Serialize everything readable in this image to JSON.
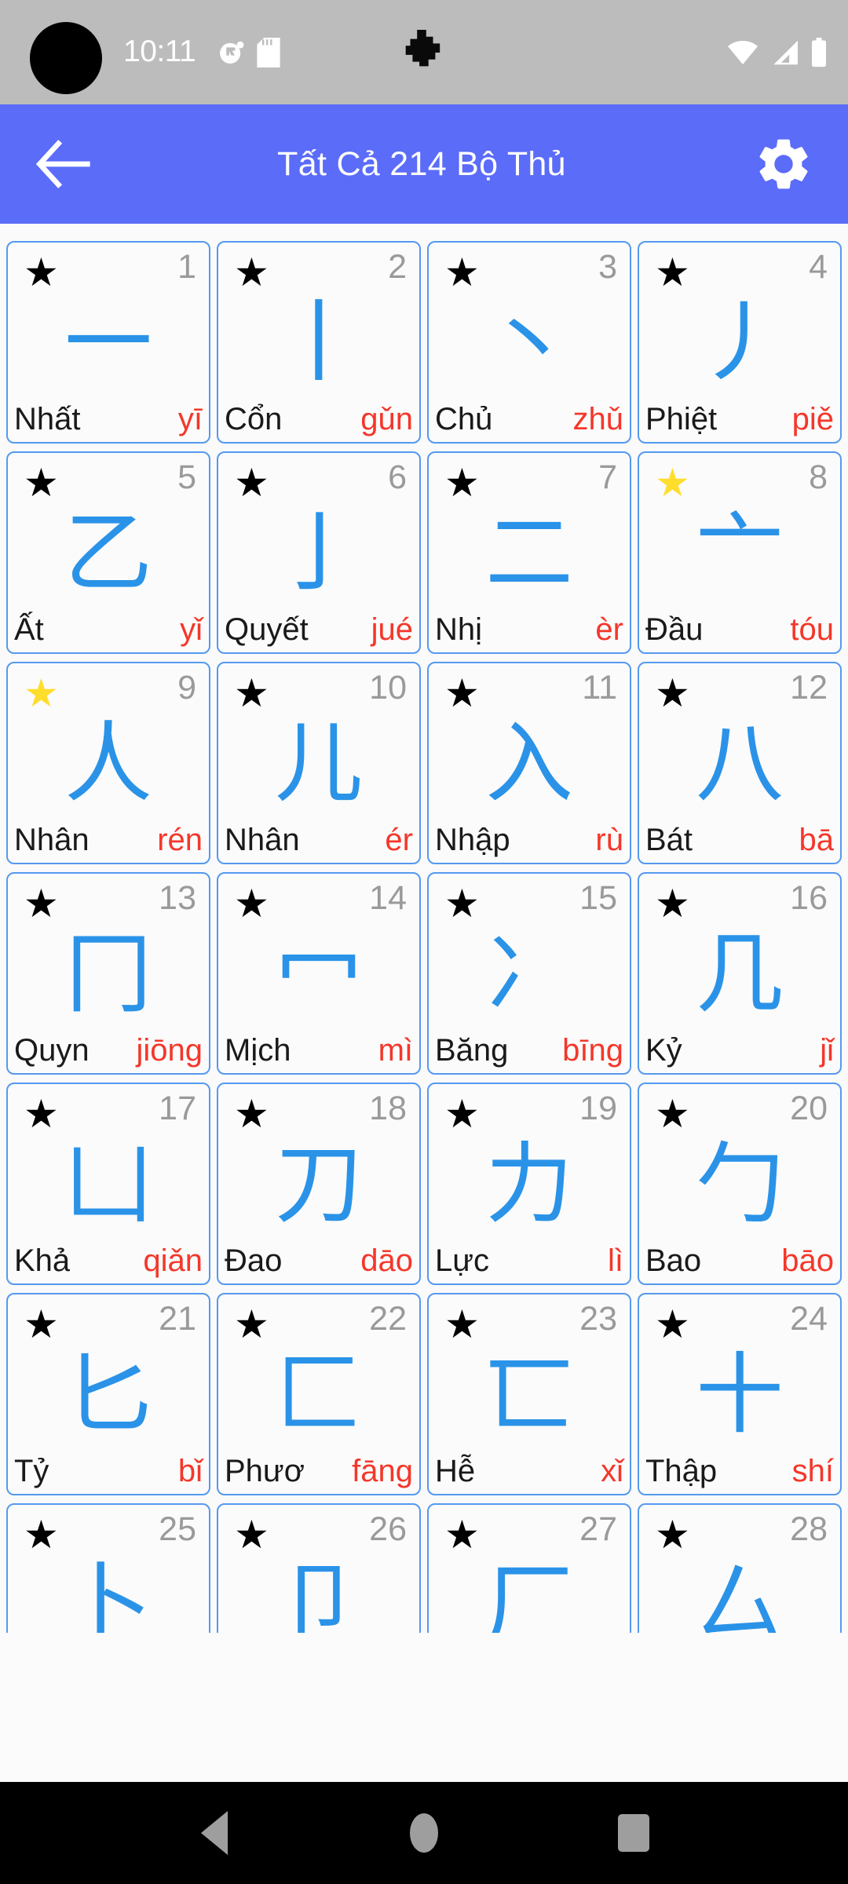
{
  "status_bar": {
    "time": "10:11",
    "icons": {
      "dnd": "do-not-disturb-icon",
      "sdcard": "sd-card-icon",
      "notification": "notification-blob-icon",
      "wifi": "wifi-icon",
      "signal": "cellular-signal-icon",
      "battery": "battery-icon"
    },
    "background_color": "#bcbcbc"
  },
  "app_bar": {
    "title": "Tất Cả 214 Bộ Thủ",
    "back_label": "back-arrow",
    "settings_label": "settings-gear",
    "background_color": "#5b6cf9"
  },
  "theme": {
    "accent": "#5b6cf9",
    "card_border": "#5599f0",
    "glyph_color": "#2a93e8",
    "pinyin_color": "#f4372a",
    "number_color": "#9a9a9a",
    "star_default": "#000000",
    "star_favorite": "#ffdd2d"
  },
  "radicals": [
    {
      "num": "1",
      "glyph": "一",
      "name": "Nhất",
      "pinyin": "yī",
      "favorite": false
    },
    {
      "num": "2",
      "glyph": "丨",
      "name": "Cổn",
      "pinyin": "gǔn",
      "favorite": false
    },
    {
      "num": "3",
      "glyph": "丶",
      "name": "Chủ",
      "pinyin": "zhǔ",
      "favorite": false
    },
    {
      "num": "4",
      "glyph": "丿",
      "name": "Phiệt",
      "pinyin": "piě",
      "favorite": false
    },
    {
      "num": "5",
      "glyph": "乙",
      "name": "Ất",
      "pinyin": "yǐ",
      "favorite": false
    },
    {
      "num": "6",
      "glyph": "亅",
      "name": "Quyết",
      "pinyin": "jué",
      "favorite": false
    },
    {
      "num": "7",
      "glyph": "二",
      "name": "Nhị",
      "pinyin": "èr",
      "favorite": false
    },
    {
      "num": "8",
      "glyph": "亠",
      "name": "Đầu",
      "pinyin": "tóu",
      "favorite": true
    },
    {
      "num": "9",
      "glyph": "人",
      "name": "Nhân",
      "pinyin": "rén",
      "favorite": true
    },
    {
      "num": "10",
      "glyph": "儿",
      "name": "Nhân",
      "pinyin": "ér",
      "favorite": false
    },
    {
      "num": "11",
      "glyph": "入",
      "name": "Nhập",
      "pinyin": "rù",
      "favorite": false
    },
    {
      "num": "12",
      "glyph": "八",
      "name": "Bát",
      "pinyin": "bā",
      "favorite": false
    },
    {
      "num": "13",
      "glyph": "冂",
      "name": "Quyn",
      "pinyin": "jiōng",
      "favorite": false
    },
    {
      "num": "14",
      "glyph": "冖",
      "name": "Mịch",
      "pinyin": "mì",
      "favorite": false
    },
    {
      "num": "15",
      "glyph": "冫",
      "name": "Băng",
      "pinyin": "bīng",
      "favorite": false
    },
    {
      "num": "16",
      "glyph": "几",
      "name": "Kỷ",
      "pinyin": "jǐ",
      "favorite": false
    },
    {
      "num": "17",
      "glyph": "凵",
      "name": "Khả",
      "pinyin": "qiǎn",
      "favorite": false
    },
    {
      "num": "18",
      "glyph": "刀",
      "name": "Đao",
      "pinyin": "dāo",
      "favorite": false
    },
    {
      "num": "19",
      "glyph": "力",
      "name": "Lực",
      "pinyin": "lì",
      "favorite": false
    },
    {
      "num": "20",
      "glyph": "勹",
      "name": "Bao",
      "pinyin": "bāo",
      "favorite": false
    },
    {
      "num": "21",
      "glyph": "匕",
      "name": "Tỷ",
      "pinyin": "bǐ",
      "favorite": false
    },
    {
      "num": "22",
      "glyph": "匚",
      "name": "Phươ",
      "pinyin": "fāng",
      "favorite": false
    },
    {
      "num": "23",
      "glyph": "匸",
      "name": "Hễ",
      "pinyin": "xǐ",
      "favorite": false
    },
    {
      "num": "24",
      "glyph": "十",
      "name": "Thập",
      "pinyin": "shí",
      "favorite": false
    },
    {
      "num": "25",
      "glyph": "卜",
      "name": "",
      "pinyin": "",
      "favorite": false
    },
    {
      "num": "26",
      "glyph": "卩",
      "name": "",
      "pinyin": "",
      "favorite": false
    },
    {
      "num": "27",
      "glyph": "厂",
      "name": "",
      "pinyin": "",
      "favorite": false
    },
    {
      "num": "28",
      "glyph": "厶",
      "name": "",
      "pinyin": "",
      "favorite": false
    }
  ],
  "nav_bar": {
    "back": "nav-back-button",
    "home": "nav-home-button",
    "recents": "nav-recents-button"
  }
}
